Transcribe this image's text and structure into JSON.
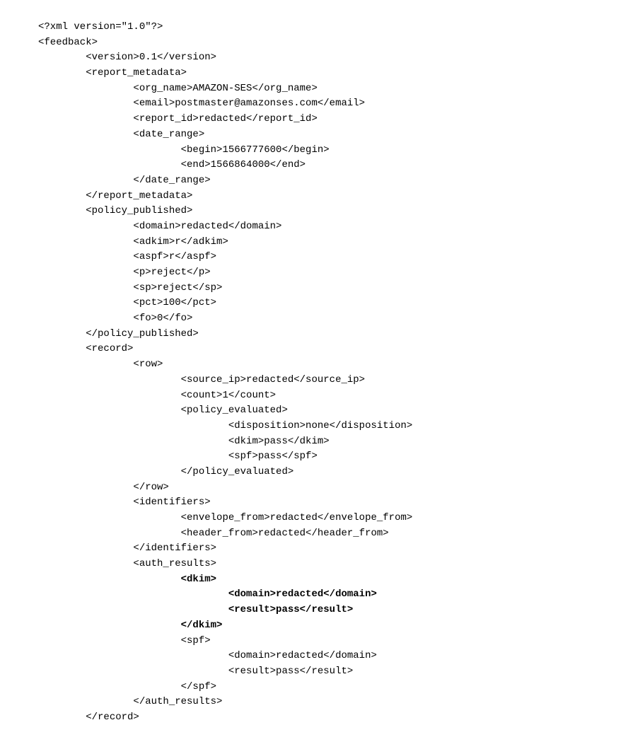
{
  "lines": [
    {
      "indent": 0,
      "bold": false,
      "text": "<?xml version=\"1.0\"?>"
    },
    {
      "indent": 0,
      "bold": false,
      "text": "<feedback>"
    },
    {
      "indent": 1,
      "bold": false,
      "text": "<version>0.1</version>"
    },
    {
      "indent": 1,
      "bold": false,
      "text": "<report_metadata>"
    },
    {
      "indent": 2,
      "bold": false,
      "text": "<org_name>AMAZON-SES</org_name>"
    },
    {
      "indent": 2,
      "bold": false,
      "text": "<email>postmaster@amazonses.com</email>"
    },
    {
      "indent": 2,
      "bold": false,
      "text": "<report_id>redacted</report_id>"
    },
    {
      "indent": 2,
      "bold": false,
      "text": "<date_range>"
    },
    {
      "indent": 3,
      "bold": false,
      "text": "<begin>1566777600</begin>"
    },
    {
      "indent": 3,
      "bold": false,
      "text": "<end>1566864000</end>"
    },
    {
      "indent": 2,
      "bold": false,
      "text": "</date_range>"
    },
    {
      "indent": 1,
      "bold": false,
      "text": "</report_metadata>"
    },
    {
      "indent": 1,
      "bold": false,
      "text": "<policy_published>"
    },
    {
      "indent": 2,
      "bold": false,
      "text": "<domain>redacted</domain>"
    },
    {
      "indent": 2,
      "bold": false,
      "text": "<adkim>r</adkim>"
    },
    {
      "indent": 2,
      "bold": false,
      "text": "<aspf>r</aspf>"
    },
    {
      "indent": 2,
      "bold": false,
      "text": "<p>reject</p>"
    },
    {
      "indent": 2,
      "bold": false,
      "text": "<sp>reject</sp>"
    },
    {
      "indent": 2,
      "bold": false,
      "text": "<pct>100</pct>"
    },
    {
      "indent": 2,
      "bold": false,
      "text": "<fo>0</fo>"
    },
    {
      "indent": 1,
      "bold": false,
      "text": "</policy_published>"
    },
    {
      "indent": 1,
      "bold": false,
      "text": "<record>"
    },
    {
      "indent": 2,
      "bold": false,
      "text": "<row>"
    },
    {
      "indent": 3,
      "bold": false,
      "text": "<source_ip>redacted</source_ip>"
    },
    {
      "indent": 3,
      "bold": false,
      "text": "<count>1</count>"
    },
    {
      "indent": 3,
      "bold": false,
      "text": "<policy_evaluated>"
    },
    {
      "indent": 4,
      "bold": false,
      "text": "<disposition>none</disposition>"
    },
    {
      "indent": 4,
      "bold": false,
      "text": "<dkim>pass</dkim>"
    },
    {
      "indent": 4,
      "bold": false,
      "text": "<spf>pass</spf>"
    },
    {
      "indent": 3,
      "bold": false,
      "text": "</policy_evaluated>"
    },
    {
      "indent": 2,
      "bold": false,
      "text": "</row>"
    },
    {
      "indent": 2,
      "bold": false,
      "text": "<identifiers>"
    },
    {
      "indent": 3,
      "bold": false,
      "text": "<envelope_from>redacted</envelope_from>"
    },
    {
      "indent": 3,
      "bold": false,
      "text": "<header_from>redacted</header_from>"
    },
    {
      "indent": 2,
      "bold": false,
      "text": "</identifiers>"
    },
    {
      "indent": 2,
      "bold": false,
      "text": "<auth_results>"
    },
    {
      "indent": 3,
      "bold": true,
      "text": "<dkim>"
    },
    {
      "indent": 4,
      "bold": true,
      "text": "<domain>redacted</domain>"
    },
    {
      "indent": 4,
      "bold": true,
      "text": "<result>pass</result>"
    },
    {
      "indent": 3,
      "bold": true,
      "text": "</dkim>"
    },
    {
      "indent": 3,
      "bold": false,
      "text": "<spf>"
    },
    {
      "indent": 4,
      "bold": false,
      "text": "<domain>redacted</domain>"
    },
    {
      "indent": 4,
      "bold": false,
      "text": "<result>pass</result>"
    },
    {
      "indent": 3,
      "bold": false,
      "text": "</spf>"
    },
    {
      "indent": 2,
      "bold": false,
      "text": "</auth_results>"
    },
    {
      "indent": 1,
      "bold": false,
      "text": "</record>"
    }
  ],
  "indentUnit": "        "
}
